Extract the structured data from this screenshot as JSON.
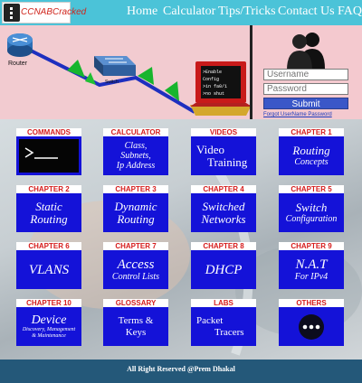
{
  "header": {
    "logo_text": "CCNABCracked",
    "nav": [
      "Home",
      "Calculator",
      "Tips/Tricks",
      "Contact Us",
      "FAQ"
    ]
  },
  "banner": {
    "router_label": "Router",
    "switch_label": "Switch",
    "terminal_lines": [
      ">Enable",
      " Config",
      " >in fa0/1",
      " >no shut"
    ]
  },
  "login": {
    "username_placeholder": "Username",
    "password_placeholder": "Password",
    "submit_label": "Submit",
    "forgot_link": "Forgot UserName Password"
  },
  "tiles": [
    {
      "head": "COMMANDS",
      "lines": []
    },
    {
      "head": "CALCULATOR",
      "lines": [
        "Class,",
        "Subnets,",
        "Ip Address"
      ]
    },
    {
      "head": "VIDEOS",
      "lines": [
        "Video",
        "Training"
      ]
    },
    {
      "head": "CHAPTER 1",
      "lines": [
        "Routing",
        "Concepts"
      ]
    },
    {
      "head": "CHAPTER 2",
      "lines": [
        "Static",
        "Routing"
      ]
    },
    {
      "head": "CHAPTER 3",
      "lines": [
        "Dynamic",
        "Routing"
      ]
    },
    {
      "head": "CHAPTER 4",
      "lines": [
        "Switched",
        "Networks"
      ]
    },
    {
      "head": "CHAPTER 5",
      "lines": [
        "Switch",
        "Configuration"
      ]
    },
    {
      "head": "CHAPTER 6",
      "lines": [
        "VLANS"
      ]
    },
    {
      "head": "CHAPTER 7",
      "lines": [
        "Access",
        "Control Lists"
      ]
    },
    {
      "head": "CHAPTER 8",
      "lines": [
        "DHCP"
      ]
    },
    {
      "head": "CHAPTER 9",
      "lines": [
        "N.A.T",
        "For IPv4"
      ]
    },
    {
      "head": "CHAPTER 10",
      "lines": [
        "Device",
        "Discovery, Management",
        "& Maintenance"
      ]
    },
    {
      "head": "GLOSSARY",
      "lines": [
        "Terms &",
        "Keys"
      ]
    },
    {
      "head": "LABS",
      "lines": [
        "Packet",
        "Tracers"
      ]
    },
    {
      "head": "OTHERS",
      "lines": []
    }
  ],
  "footer": {
    "text": "All Right Reserved @Prem Dhakal"
  },
  "colors": {
    "header": "#4bc3d8",
    "tile_body": "#1412d8",
    "tile_head_text": "#d51b1b",
    "footer": "#245879"
  }
}
